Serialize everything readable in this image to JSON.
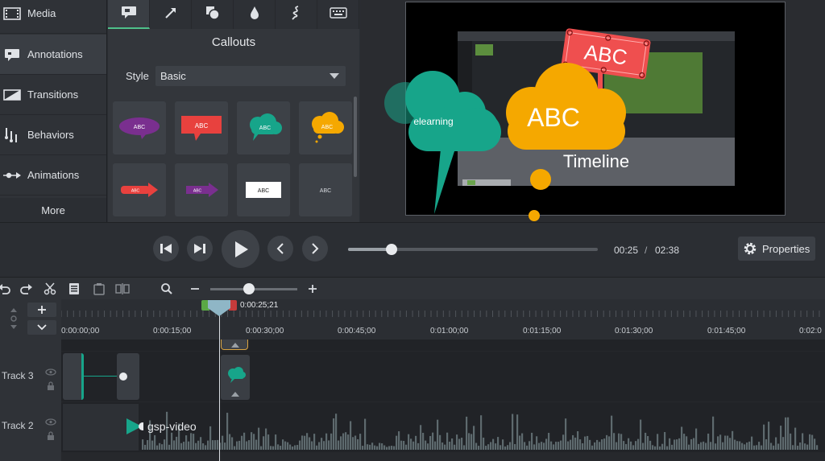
{
  "sidebar": {
    "items": [
      {
        "label": "Media",
        "icon": "film-icon"
      },
      {
        "label": "Annotations",
        "icon": "callout-icon"
      },
      {
        "label": "Transitions",
        "icon": "transition-icon"
      },
      {
        "label": "Behaviors",
        "icon": "behaviors-icon"
      },
      {
        "label": "Animations",
        "icon": "animation-arrow-icon"
      }
    ],
    "more_label": "More"
  },
  "annotations": {
    "tabs": [
      "callout-tab-icon",
      "arrow-tab-icon",
      "shape-tab-icon",
      "blur-tab-icon",
      "sketch-tab-icon",
      "keystroke-tab-icon"
    ],
    "title": "Callouts",
    "style_label": "Style",
    "style_value": "Basic",
    "tiles": [
      {
        "text": "ABC",
        "color": "#7a2f8f"
      },
      {
        "text": "ABC",
        "color": "#e8413e"
      },
      {
        "text": "ABC",
        "color": "#17a58a"
      },
      {
        "text": "ABC",
        "color": "#f5a800"
      },
      {
        "text": "ABC",
        "color": "#e8413e"
      },
      {
        "text": "ABC",
        "color": "#7a2f8f"
      },
      {
        "text": "ABC",
        "color": "#ffffff"
      },
      {
        "text": "ABC",
        "color": "#3d4147"
      }
    ]
  },
  "preview": {
    "teal_callout": "elearning",
    "orange_callout": "ABC",
    "red_sign": "ABC",
    "timeline_text": "Timeline",
    "colors": {
      "teal": "#17a58a",
      "orange": "#f5a800",
      "red": "#ef4f4f"
    }
  },
  "transport": {
    "current_time": "00:25",
    "separator": "/",
    "total_time": "02:38",
    "progress": 0.16,
    "properties_label": "Properties"
  },
  "toolbar": {
    "zoom": 0.45
  },
  "timeline": {
    "playhead_time": "0:00:25;21",
    "ruler_labels": [
      "0:00:00;00",
      "0:00:15;00",
      "0:00:30;00",
      "0:00:45;00",
      "0:01:00;00",
      "0:01:15;00",
      "0:01:30;00",
      "0:01:45;00",
      "0:02:0"
    ],
    "tracks": [
      {
        "name": "Track 3"
      },
      {
        "name": "Track 2",
        "clip": "gsp-video"
      }
    ]
  }
}
